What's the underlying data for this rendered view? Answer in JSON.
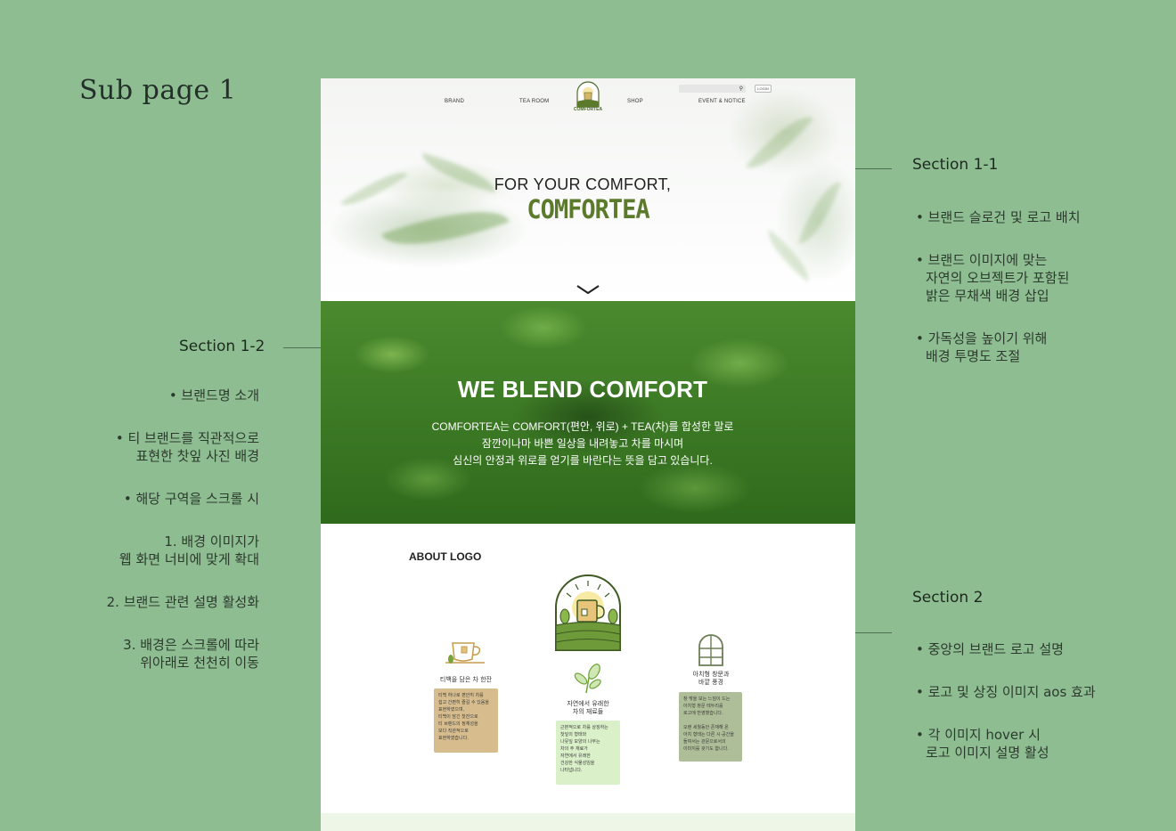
{
  "page": {
    "heading": "Sub page 1"
  },
  "annotations": {
    "s11": {
      "title": "Section 1-1",
      "items": [
        "브랜드 슬로건 및 로고 배치",
        "브랜드 이미지에 맞는\n자연의 오브젝트가 포함된\n밝은 무채색 배경 삽입",
        "가독성을 높이기 위해\n배경 투명도 조절"
      ]
    },
    "s12": {
      "title": "Section 1-2",
      "items": [
        "• 브랜드명 소개",
        "• 티 브랜드를 직관적으로\n표현한 찻잎 사진 배경",
        "• 해당 구역을 스크롤 시",
        "1. 배경 이미지가\n웹 화면 너비에 맞게 확대",
        "2. 브랜드 관련 설명 활성화",
        "3. 배경은 스크롤에 따라\n위아래로 천천히 이동"
      ]
    },
    "s2": {
      "title": "Section 2",
      "items": [
        "중앙의 브랜드 로고 설명",
        "로고 및 상징 이미지 aos 효과",
        "각 이미지 hover 시\n로고 이미지 설명 활성"
      ]
    }
  },
  "nav": {
    "items": [
      "BRAND",
      "TEA ROOM",
      "SHOP",
      "EVENT & NOTICE"
    ],
    "logo_text": "COMFORTEA",
    "login": "LOGIN",
    "search_icon": "search-icon"
  },
  "hero": {
    "slogan": "FOR YOUR COMFORT,",
    "brand": "COMFORTEA"
  },
  "blend": {
    "title": "WE BLEND COMFORT",
    "lines": [
      "COMFORTEA는 COMFORT(편안, 위로) + TEA(차)를 합성한 말로",
      "잠깐이나마 바쁜 일상을 내려놓고 차를 마시며",
      "심신의 안정과 위로를 얻기를 바란다는 뜻을 담고 있습니다."
    ]
  },
  "about": {
    "title": "ABOUT LOGO",
    "cards": [
      {
        "label": "티백을 담은 차 한잔",
        "desc": "티백 하나로 편안히 차를\n쉽고 간편히 즐길 수 있음을\n표현하였으며,\n티백이 담긴 찻잔으로\n티 브랜드의 정체성을\n보다 직관적으로\n표현하였습니다."
      },
      {
        "label": "자연에서 유래한\n차의 재료들",
        "desc": "근본적으로 차를 상징하는\n찻잎의 형태와\n나뭇잎 모양의 나무는\n차의 주 재료가\n자연에서 유래한\n건강한 식물성임을\n나타냅니다."
      },
      {
        "label": "아치형 창문과\n바깥 풍경",
        "desc": "창 밖을 보는 느낌이 드는\n아치형 창문 테두리를\n로고에 반영했습니다.\n\n오랜 세월동안 존재해 온\n아치 형태는 다른 시·공간을\n들여서는 관문으로서의\n이미지를 갖기도 합니다."
      }
    ]
  },
  "colors": {
    "background": "#8fbd92",
    "brand_green": "#5c7a2c",
    "card_tan": "#d7bd8e",
    "card_mint": "#d9f0c9",
    "card_sage": "#aebe98"
  }
}
